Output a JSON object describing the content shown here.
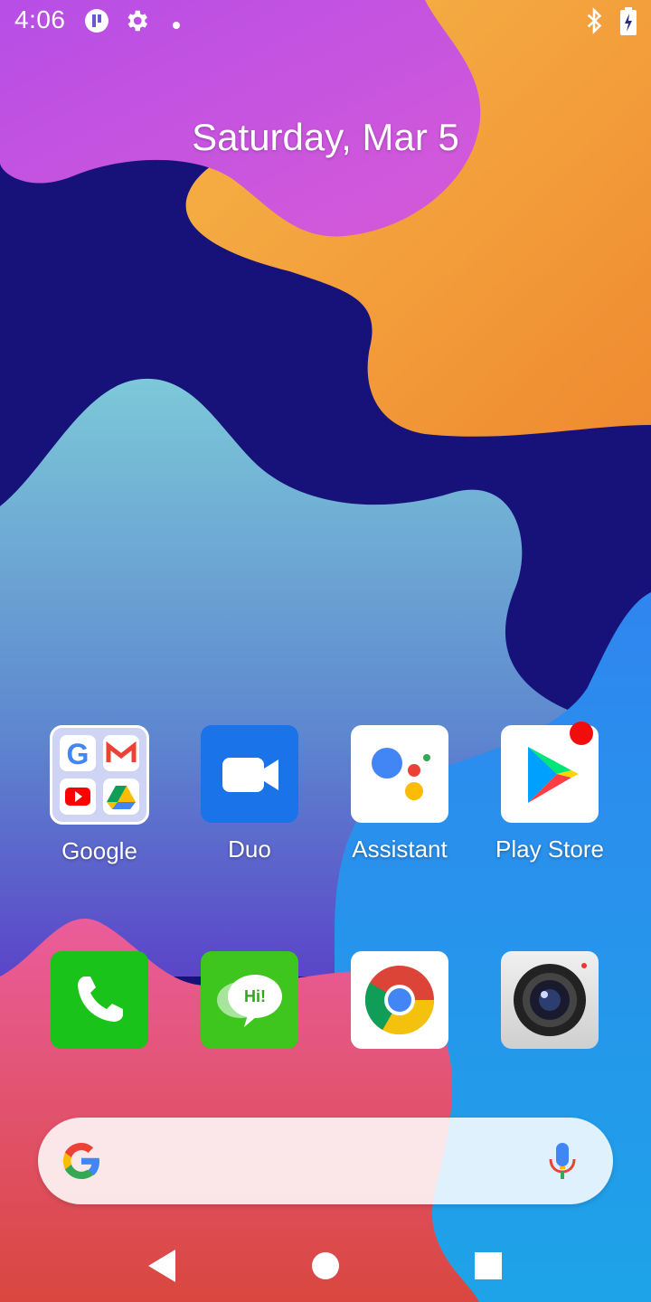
{
  "status_bar": {
    "time": "4:06",
    "left_icons": [
      "signal-app-icon",
      "settings-gear-icon",
      "dot-icon"
    ],
    "right_icons": [
      "bluetooth-icon",
      "battery-charging-icon"
    ]
  },
  "home": {
    "date": "Saturday, Mar 5"
  },
  "apps_row1": [
    {
      "label": "Google",
      "icon": "google-folder-icon"
    },
    {
      "label": "Duo",
      "icon": "duo-icon"
    },
    {
      "label": "Assistant",
      "icon": "assistant-icon"
    },
    {
      "label": "Play Store",
      "icon": "play-store-icon",
      "has_notification_badge": true
    }
  ],
  "apps_row2": [
    {
      "icon": "phone-icon"
    },
    {
      "icon": "messages-icon",
      "icon_text": "Hi!"
    },
    {
      "icon": "chrome-icon"
    },
    {
      "icon": "camera-icon"
    }
  ],
  "search": {
    "logo": "google-g-icon",
    "mic": "microphone-icon"
  },
  "nav": [
    "back-icon",
    "home-icon",
    "recents-icon"
  ],
  "colors": {
    "wallpaper_navy": "#16127a",
    "orange": "#f29a38",
    "magenta": "#c552e0",
    "teal": "#6ab5d6",
    "blue": "#2a8fe8",
    "red_pink": "#e0476e",
    "badge": "#f20d0d"
  }
}
